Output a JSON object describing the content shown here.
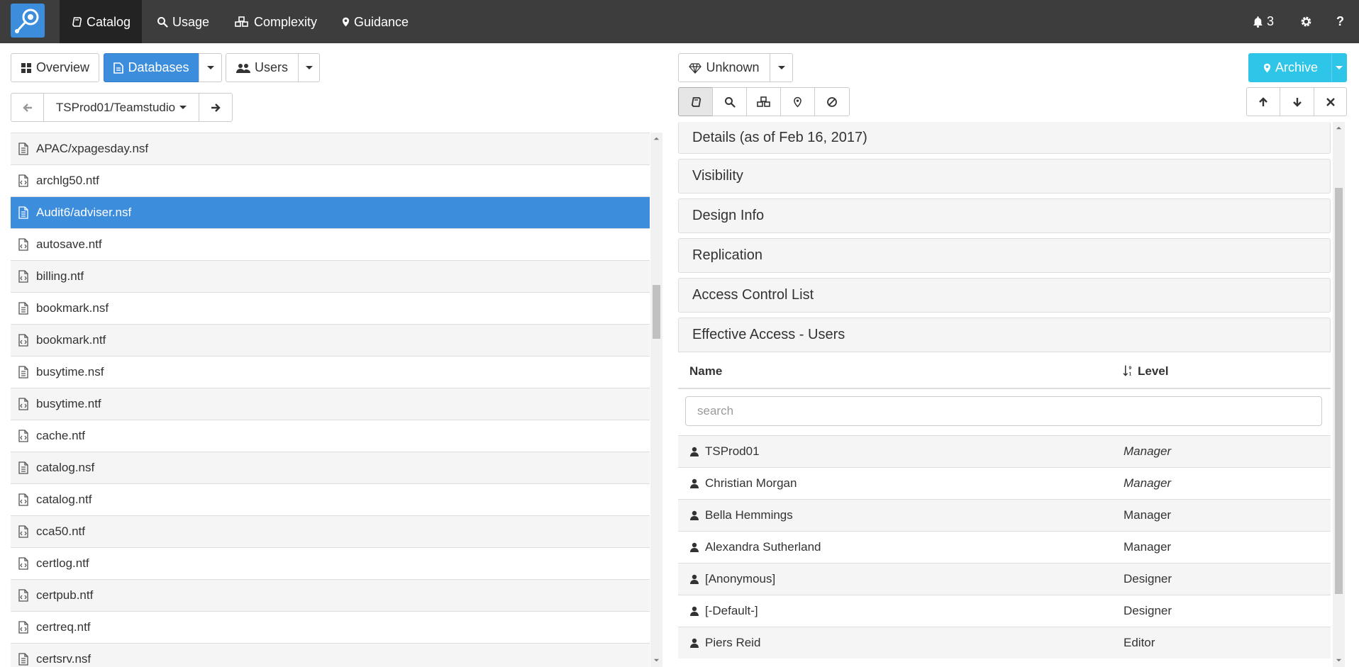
{
  "nav": {
    "items": [
      {
        "label": "Catalog",
        "icon": "book-icon"
      },
      {
        "label": "Usage",
        "icon": "search-icon"
      },
      {
        "label": "Complexity",
        "icon": "cubes-icon"
      },
      {
        "label": "Guidance",
        "icon": "map-marker-icon"
      }
    ],
    "notification_count": "3"
  },
  "left": {
    "overview_label": "Overview",
    "databases_label": "Databases",
    "users_label": "Users",
    "path_label": "TSProd01/Teamstudio",
    "files": [
      {
        "name": "APAC/xpagesday.nsf",
        "type": "nsf"
      },
      {
        "name": "archlg50.ntf",
        "type": "ntf"
      },
      {
        "name": "Audit6/adviser.nsf",
        "type": "nsf"
      },
      {
        "name": "autosave.ntf",
        "type": "ntf"
      },
      {
        "name": "billing.ntf",
        "type": "ntf"
      },
      {
        "name": "bookmark.nsf",
        "type": "nsf"
      },
      {
        "name": "bookmark.ntf",
        "type": "ntf"
      },
      {
        "name": "busytime.nsf",
        "type": "nsf"
      },
      {
        "name": "busytime.ntf",
        "type": "ntf"
      },
      {
        "name": "cache.ntf",
        "type": "ntf"
      },
      {
        "name": "catalog.nsf",
        "type": "nsf"
      },
      {
        "name": "catalog.ntf",
        "type": "ntf"
      },
      {
        "name": "cca50.ntf",
        "type": "ntf"
      },
      {
        "name": "certlog.ntf",
        "type": "ntf"
      },
      {
        "name": "certpub.ntf",
        "type": "ntf"
      },
      {
        "name": "certreq.ntf",
        "type": "ntf"
      },
      {
        "name": "certsrv.nsf",
        "type": "nsf"
      }
    ],
    "selected_index": 2
  },
  "right": {
    "unknown_label": "Unknown",
    "archive_label": "Archive",
    "panels": [
      "Details (as of Feb 16, 2017)",
      "Visibility",
      "Design Info",
      "Replication",
      "Access Control List",
      "Effective Access - Users"
    ],
    "table": {
      "col_name": "Name",
      "col_level": "Level",
      "search_placeholder": "search",
      "rows": [
        {
          "name": "TSProd01",
          "level": "Manager",
          "italic": true
        },
        {
          "name": "Christian Morgan",
          "level": "Manager",
          "italic": true
        },
        {
          "name": "Bella Hemmings",
          "level": "Manager",
          "italic": false
        },
        {
          "name": "Alexandra Sutherland",
          "level": "Manager",
          "italic": false
        },
        {
          "name": "[Anonymous]",
          "level": "Designer",
          "italic": false
        },
        {
          "name": "[-Default-]",
          "level": "Designer",
          "italic": false
        },
        {
          "name": "Piers Reid",
          "level": "Editor",
          "italic": false
        }
      ]
    }
  },
  "colors": {
    "navbar": "#3d3d3d",
    "primary": "#3c8ddc",
    "info": "#2ec5e8"
  }
}
